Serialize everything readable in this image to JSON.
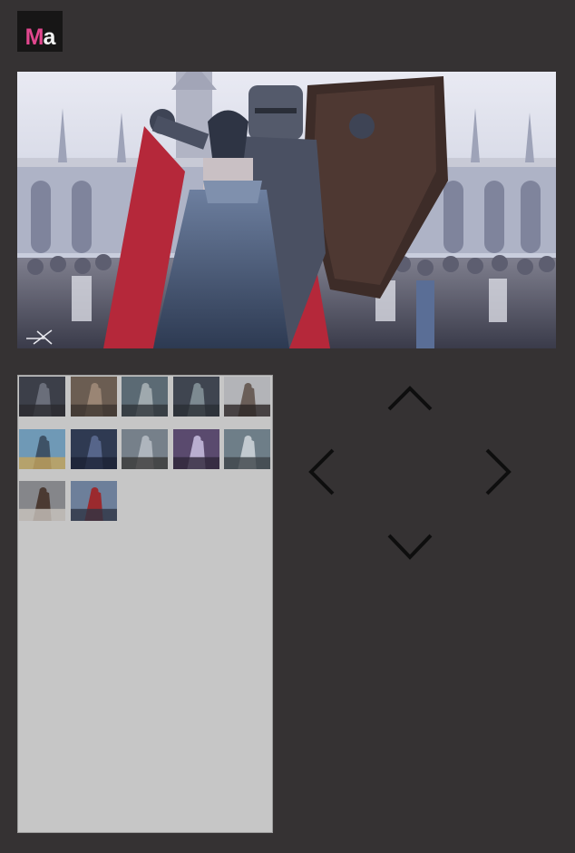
{
  "logo": {
    "m": "M",
    "a": "a"
  },
  "main_image": {
    "description_icon": "signature-mark-icon"
  },
  "thumbnails": [
    {
      "id": 1,
      "tone": [
        "#3c3f49",
        "#6a6e7a",
        "#2a2b30"
      ]
    },
    {
      "id": 2,
      "tone": [
        "#6b5d52",
        "#9a8574",
        "#3c3530"
      ]
    },
    {
      "id": 3,
      "tone": [
        "#5b6a74",
        "#9fa9ae",
        "#2f3439"
      ]
    },
    {
      "id": 4,
      "tone": [
        "#3f4550",
        "#7d8a91",
        "#2a2e35"
      ]
    },
    {
      "id": 5,
      "tone": [
        "#b3b4b8",
        "#6a5e58",
        "#2c2626"
      ]
    },
    {
      "id": 6,
      "tone": [
        "#6f99b6",
        "#3e5266",
        "#c7a45a"
      ]
    },
    {
      "id": 7,
      "tone": [
        "#2f3a52",
        "#56658a",
        "#1c2234"
      ]
    },
    {
      "id": 8,
      "tone": [
        "#76808a",
        "#aeb5bd",
        "#3a3837"
      ]
    },
    {
      "id": 9,
      "tone": [
        "#5a4a6e",
        "#b9aed0",
        "#2e2638"
      ]
    },
    {
      "id": 10,
      "tone": [
        "#6e7e88",
        "#c2cad0",
        "#3d4448"
      ]
    },
    {
      "id": 11,
      "tone": [
        "#85868a",
        "#4b3a32",
        "#c9c4be"
      ]
    },
    {
      "id": 12,
      "tone": [
        "#6d7f9a",
        "#9b2a2e",
        "#2e3444"
      ]
    }
  ],
  "controls": {
    "up": "chevron-up-icon",
    "down": "chevron-down-icon",
    "left": "chevron-left-icon",
    "right": "chevron-right-icon"
  }
}
